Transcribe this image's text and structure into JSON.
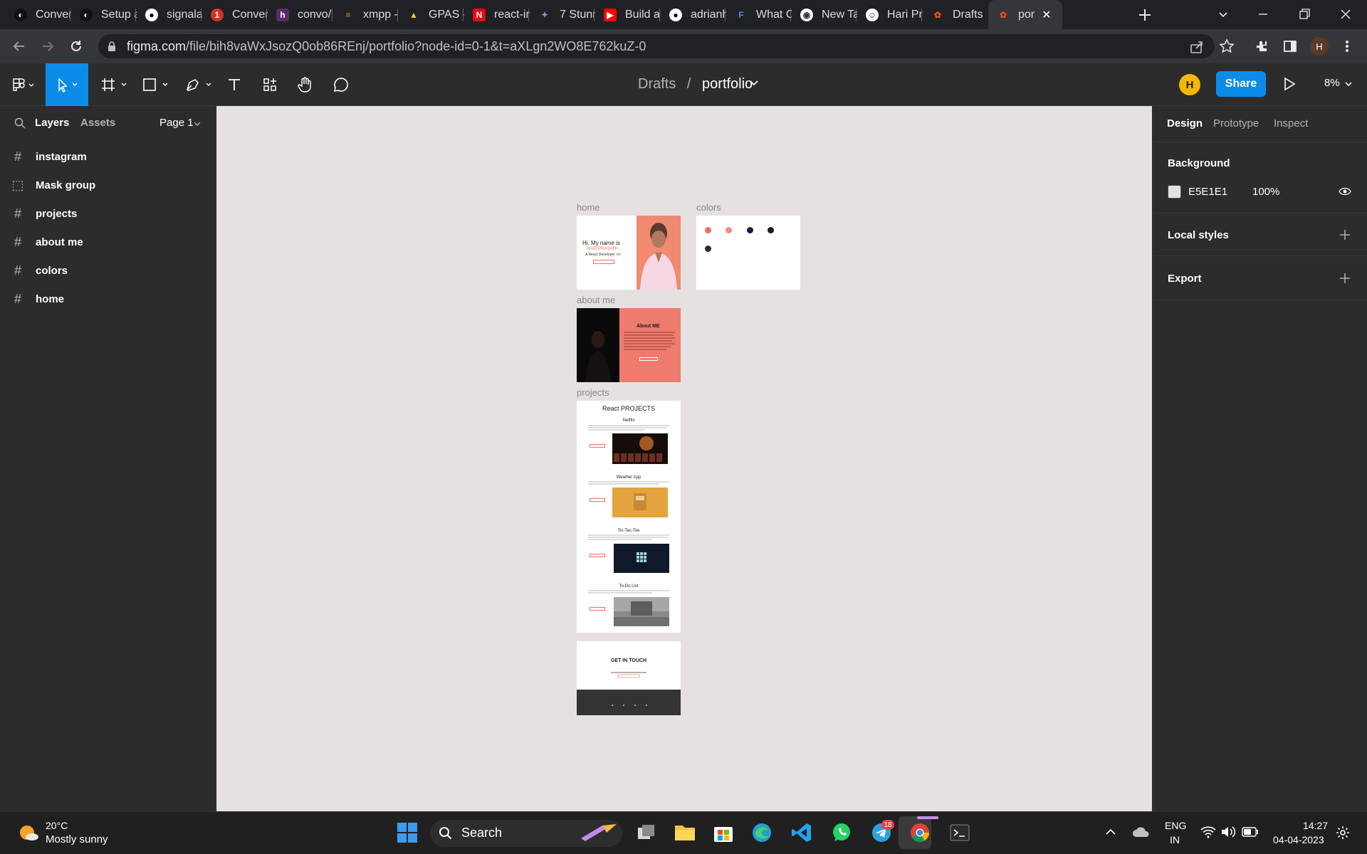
{
  "browser": {
    "tabs": [
      {
        "title": "Conver",
        "icon": "conversations-icon"
      },
      {
        "title": "Setup a",
        "icon": "conversations-icon"
      },
      {
        "title": "signala",
        "icon": "github-icon"
      },
      {
        "title": "Conver",
        "icon": "notification-icon"
      },
      {
        "title": "convo/",
        "icon": "heroku-icon"
      },
      {
        "title": "xmpp -",
        "icon": "stackoverflow-icon"
      },
      {
        "title": "GPAS –",
        "icon": "firebase-icon"
      },
      {
        "title": "react-in",
        "icon": "netflix-icon"
      },
      {
        "title": "7 Stunn",
        "icon": "medium-icon"
      },
      {
        "title": "Build ai",
        "icon": "youtube-icon"
      },
      {
        "title": "adrianh",
        "icon": "github-icon"
      },
      {
        "title": "What C",
        "icon": "framer-icon"
      },
      {
        "title": "New Ta",
        "icon": "chrome-icon"
      },
      {
        "title": "Hari Pr",
        "icon": "alien-icon"
      },
      {
        "title": "Drafts",
        "icon": "figma-icon"
      },
      {
        "title": "por",
        "icon": "figma-icon",
        "active": true
      }
    ],
    "url_host": "figma.com",
    "url_path": "/file/bih8vaWxJsozQ0ob86REnj/portfolio?node-id=0-1&t=aXLgn2WO8E762kuZ-0",
    "profile_initial": "H"
  },
  "toolbar": {
    "breadcrumb_parent": "Drafts",
    "breadcrumb_sep": "/",
    "file_name": "portfolio",
    "user_initial": "H",
    "share_label": "Share",
    "zoom": "8%"
  },
  "left_panel": {
    "tab_layers": "Layers",
    "tab_assets": "Assets",
    "page": "Page 1",
    "layers": [
      {
        "name": "instagram",
        "icon": "frame-icon"
      },
      {
        "name": "Mask group",
        "icon": "mask-group-icon"
      },
      {
        "name": "projects",
        "icon": "frame-icon"
      },
      {
        "name": "about me",
        "icon": "frame-icon"
      },
      {
        "name": "colors",
        "icon": "frame-icon"
      },
      {
        "name": "home",
        "icon": "frame-icon"
      }
    ]
  },
  "canvas": {
    "background": "#E5E1E1",
    "frames": {
      "home": {
        "label": "home",
        "line1": "Hi, My name is",
        "line2": "HARI PRASATH",
        "line3": "A React Developer </>"
      },
      "colors": {
        "label": "colors",
        "swatches": [
          "#ef6f5a",
          "#f5897a",
          "#1c1d3b",
          "#1a1a1a",
          "#2d2d2d"
        ]
      },
      "about": {
        "label": "about me",
        "heading": "About ME"
      },
      "projects": {
        "label": "projects",
        "heading": "React PROJECTS",
        "items": [
          "Netflix",
          "Weather App",
          "Tic-Tac-Toe",
          "To-Do List"
        ]
      },
      "contact": {
        "heading": "GET IN TOUCH"
      }
    }
  },
  "right_panel": {
    "tab_design": "Design",
    "tab_prototype": "Prototype",
    "tab_inspect": "Inspect",
    "background_title": "Background",
    "bg_hex": "E5E1E1",
    "bg_opacity": "100%",
    "local_styles": "Local styles",
    "export": "Export"
  },
  "taskbar": {
    "weather_temp": "20°C",
    "weather_desc": "Mostly sunny",
    "search_label": "Search",
    "lang1": "ENG",
    "lang2": "IN",
    "time": "14:27",
    "date": "04-04-2023",
    "telegram_badge": "18"
  }
}
